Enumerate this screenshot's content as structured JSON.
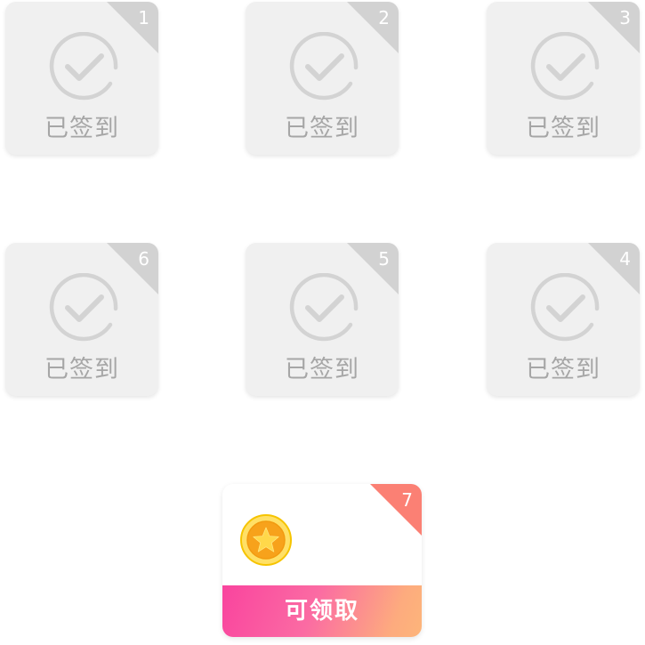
{
  "days": [
    {
      "number": "1",
      "label": "已签到"
    },
    {
      "number": "2",
      "label": "已签到"
    },
    {
      "number": "3",
      "label": "已签到"
    },
    {
      "number": "6",
      "label": "已签到"
    },
    {
      "number": "5",
      "label": "已签到"
    },
    {
      "number": "4",
      "label": "已签到"
    }
  ],
  "reward": {
    "number": "7",
    "button_label": "可领取",
    "icon": "gold-star-coin-icon"
  },
  "colors": {
    "card_bg": "#f0f0f0",
    "corner_gray": "#d2d2d2",
    "label_gray": "#a6a6a6",
    "reward_corner": "#fb8074",
    "button_gradient_start": "#f9449e",
    "button_gradient_end": "#fdb57a"
  }
}
